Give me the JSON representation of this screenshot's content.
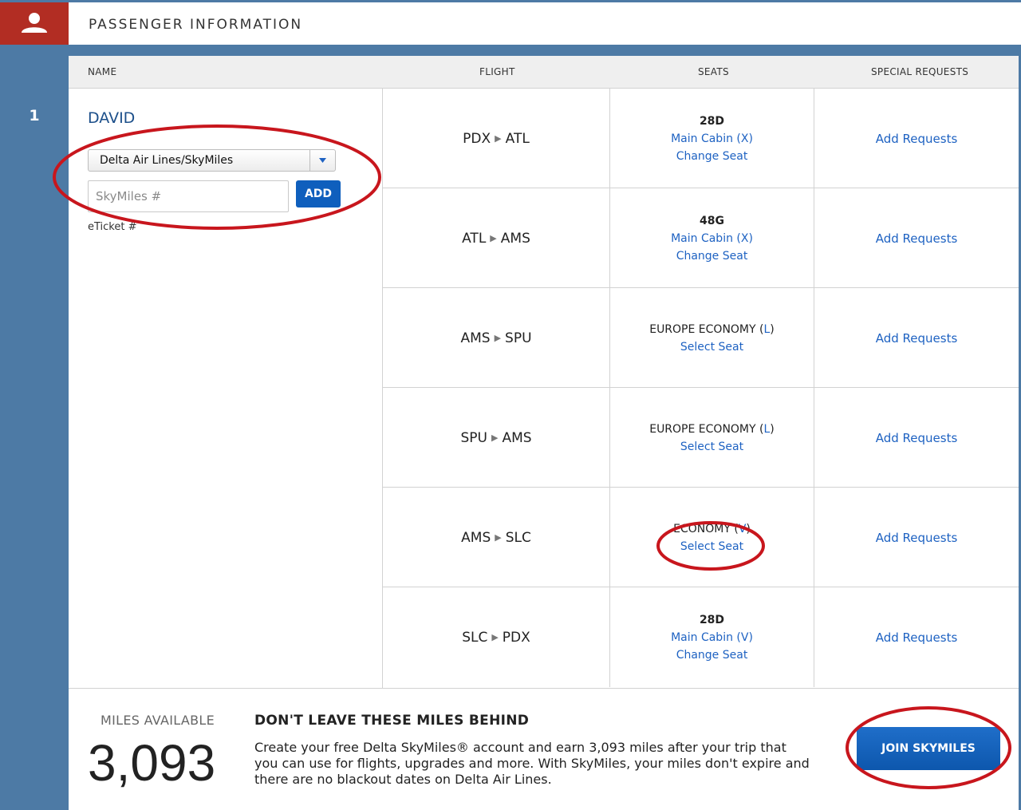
{
  "section": {
    "title": "PASSENGER INFORMATION",
    "icon": "person-icon"
  },
  "table": {
    "headers": {
      "name": "NAME",
      "flight": "FLIGHT",
      "seats": "SEATS",
      "requests": "SPECIAL REQUESTS"
    }
  },
  "passenger": {
    "number": "1",
    "name": "DAVID",
    "program_selected": "Delta Air Lines/SkyMiles",
    "miles_placeholder": "SkyMiles #",
    "add_label": "ADD",
    "eticket_label": "eTicket #"
  },
  "flights": [
    {
      "origin": "PDX",
      "destination": "ATL",
      "seat": "28D",
      "cabin": "Main Cabin (X)",
      "seat_action": "Change Seat",
      "request_action": "Add Requests"
    },
    {
      "origin": "ATL",
      "destination": "AMS",
      "seat": "48G",
      "cabin": "Main Cabin (X)",
      "seat_action": "Change Seat",
      "request_action": "Add Requests"
    },
    {
      "origin": "AMS",
      "destination": "SPU",
      "cabin_name": "EUROPE ECONOMY",
      "fare_class": "L",
      "seat_action": "Select Seat",
      "request_action": "Add Requests"
    },
    {
      "origin": "SPU",
      "destination": "AMS",
      "cabin_name": "EUROPE ECONOMY",
      "fare_class": "L",
      "seat_action": "Select Seat",
      "request_action": "Add Requests"
    },
    {
      "origin": "AMS",
      "destination": "SLC",
      "cabin_name": "ECONOMY",
      "fare_class": "V",
      "seat_action": "Select Seat",
      "request_action": "Add Requests"
    },
    {
      "origin": "SLC",
      "destination": "PDX",
      "seat": "28D",
      "cabin": "Main Cabin (V)",
      "seat_action": "Change Seat",
      "request_action": "Add Requests"
    }
  ],
  "miles": {
    "label": "MILES AVAILABLE",
    "value": "3,093",
    "promo_title": "DON'T LEAVE THESE MILES BEHIND",
    "promo_text": "Create your free Delta SkyMiles® account and earn 3,093 miles after your trip that you can use for flights, upgrades and more. With SkyMiles, your miles don't expire and there are no blackout dates on Delta Air Lines.",
    "join_label": "JOIN SKYMILES"
  },
  "colors": {
    "rail_blue": "#4d7aa5",
    "icon_red": "#b22d23",
    "link_blue": "#1e62c2",
    "button_blue": "#0f5fbd",
    "annotation_red": "#c8161d"
  }
}
